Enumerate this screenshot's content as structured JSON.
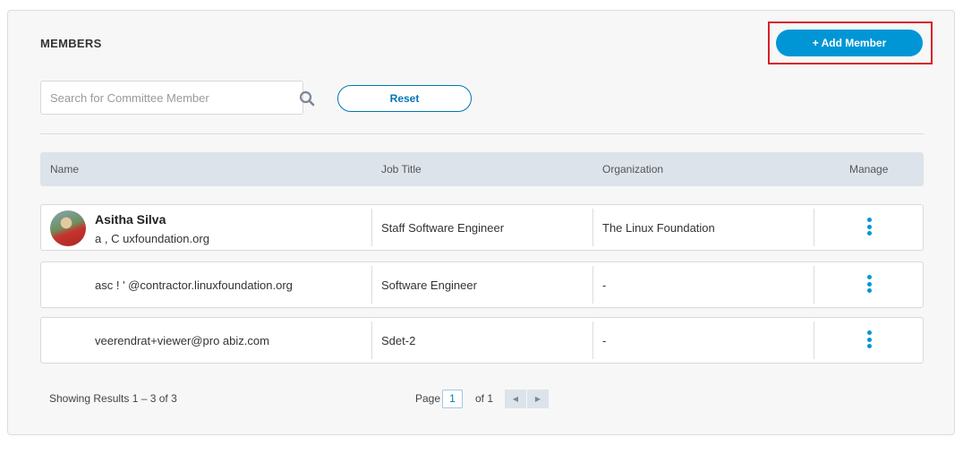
{
  "header": {
    "title": "MEMBERS",
    "add_button_label": "+ Add Member"
  },
  "search": {
    "placeholder": "Search for Committee Member",
    "value": "",
    "icon": "search-icon",
    "reset_label": "Reset"
  },
  "table": {
    "columns": [
      "Name",
      "Job Title",
      "Organization",
      "Manage"
    ],
    "rows": [
      {
        "name": "Asitha Silva",
        "email": "a   ,   C   uxfoundation.org",
        "job_title": "Staff Software Engineer",
        "organization": "The Linux Foundation",
        "has_avatar": true
      },
      {
        "name": "",
        "email": "asc   !  ' @contractor.linuxfoundation.org",
        "job_title": "Software Engineer",
        "organization": "-",
        "has_avatar": false
      },
      {
        "name": "",
        "email": "veerendrat+viewer@pro     abiz.com",
        "job_title": "Sdet-2",
        "organization": "-",
        "has_avatar": false
      }
    ]
  },
  "footer": {
    "results_text": "Showing Results 1 – 3 of 3",
    "page_label": "Page",
    "page_value": "1",
    "of_label": "of 1",
    "prev_icon": "◀",
    "next_icon": "▶"
  },
  "colors": {
    "accent": "#0096d6",
    "highlight": "#d6202b",
    "header_bg": "#dde3ea"
  }
}
